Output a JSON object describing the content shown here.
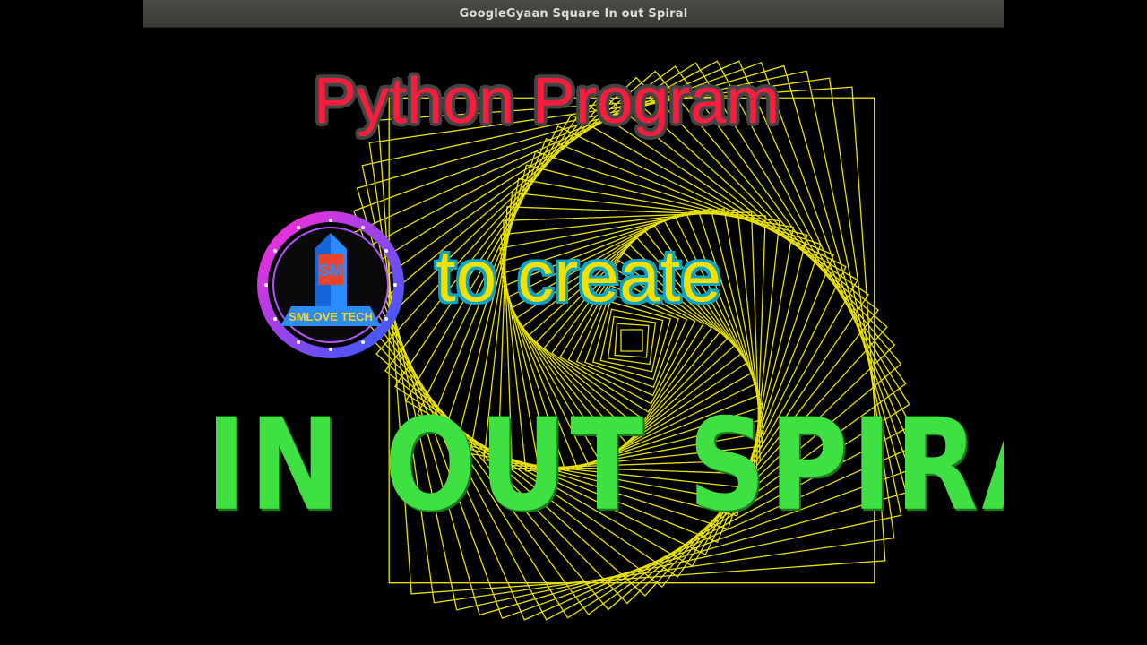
{
  "window": {
    "title": "GoogleGyaan Square In out Spiral"
  },
  "video": {
    "title": "Python Program",
    "subtitle": "to create",
    "headline": "IN OUT SPIRAL"
  },
  "logo": {
    "label": "SMLOVE TECH",
    "monogram": "SM"
  },
  "colors": {
    "title": "#ff1b3c",
    "subtitle": "#f2e100",
    "headline": "#3ee042",
    "spiral": "#e8e100",
    "logo_ring_start": "#ff2bd6",
    "logo_ring_end": "#2f5cff"
  }
}
